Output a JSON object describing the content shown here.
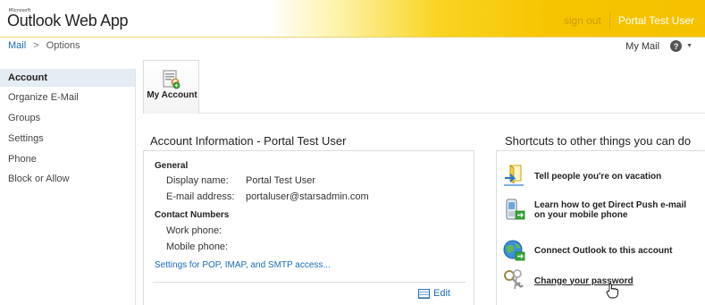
{
  "app": {
    "logo_prefix": "Microsoft",
    "logo": "Outlook Web App",
    "signout": "sign out",
    "user": "Portal Test User"
  },
  "breadcrumb": {
    "mail": "Mail",
    "separator": ">",
    "current": "Options"
  },
  "mailbox_menu": {
    "label": "My Mail",
    "help_icon": "help-icon",
    "help_glyph": "?",
    "caret": "▼"
  },
  "sidebar": {
    "items": [
      {
        "label": "Account",
        "active": true
      },
      {
        "label": "Organize E-Mail"
      },
      {
        "label": "Groups"
      },
      {
        "label": "Settings"
      },
      {
        "label": "Phone"
      },
      {
        "label": "Block or Allow"
      }
    ]
  },
  "tabs": [
    {
      "label": "My Account",
      "icon": "my-account-icon",
      "selected": true
    }
  ],
  "account": {
    "title": "Account Information - Portal Test User",
    "general_heading": "General",
    "display_name_label": "Display name:",
    "display_name": "Portal Test User",
    "email_label": "E-mail address:",
    "email": "portaluser@starsadmin.com",
    "contact_heading": "Contact Numbers",
    "work_phone_label": "Work phone:",
    "work_phone": "",
    "mobile_phone_label": "Mobile phone:",
    "mobile_phone": "",
    "pop_link": "Settings for POP, IMAP, and SMTP access...",
    "edit": "Edit"
  },
  "shortcuts": {
    "title": "Shortcuts to other things you can do",
    "items": [
      {
        "label": "Tell people you're on vacation",
        "icon": "vacation-icon"
      },
      {
        "label": "Learn how to get Direct Push e-mail on your mobile phone",
        "icon": "mobile-phone-icon"
      },
      {
        "label": "Connect Outlook to this account",
        "icon": "outlook-globe-icon"
      },
      {
        "label": "Change your password",
        "icon": "keys-icon"
      }
    ]
  },
  "colors": {
    "link": "#1a6bb8",
    "header_gold": "#f7c400",
    "selected_nav": "#e6ecf4"
  }
}
